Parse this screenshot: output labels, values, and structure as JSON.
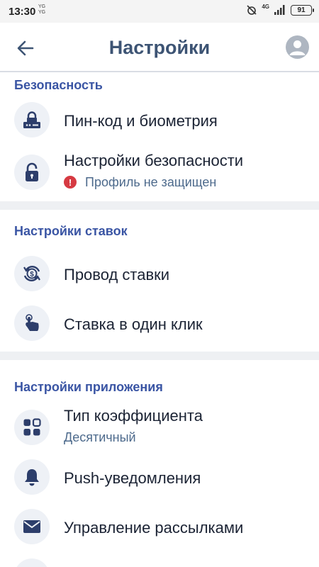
{
  "status_bar": {
    "time": "13:30",
    "carrier_top": "YG",
    "carrier_bottom": "YG",
    "network": "4G",
    "battery": "91"
  },
  "header": {
    "title": "Настройки"
  },
  "sections": {
    "security": {
      "title": "Безопасность",
      "items": [
        {
          "label": "Пин-код и биометрия",
          "icon": "lock-keypad-icon"
        },
        {
          "label": "Настройки безопасности",
          "sub": "Профиль не защищен",
          "icon": "padlock-icon"
        }
      ]
    },
    "bets": {
      "title": "Настройки ставок",
      "items": [
        {
          "label": "Провод ставки",
          "icon": "dollar-cycle-icon"
        },
        {
          "label": "Ставка в один клик",
          "icon": "tap-hand-icon"
        }
      ]
    },
    "app": {
      "title": "Настройки приложения",
      "items": [
        {
          "label": "Тип коэффициента",
          "sub": "Десятичный",
          "icon": "grid-icon"
        },
        {
          "label": "Push-уведомления",
          "icon": "bell-icon"
        },
        {
          "label": "Управление рассылками",
          "icon": "mail-icon"
        }
      ]
    }
  },
  "colors": {
    "accent": "#3a55a4",
    "title": "#3d5474",
    "warning": "#d63a42"
  }
}
